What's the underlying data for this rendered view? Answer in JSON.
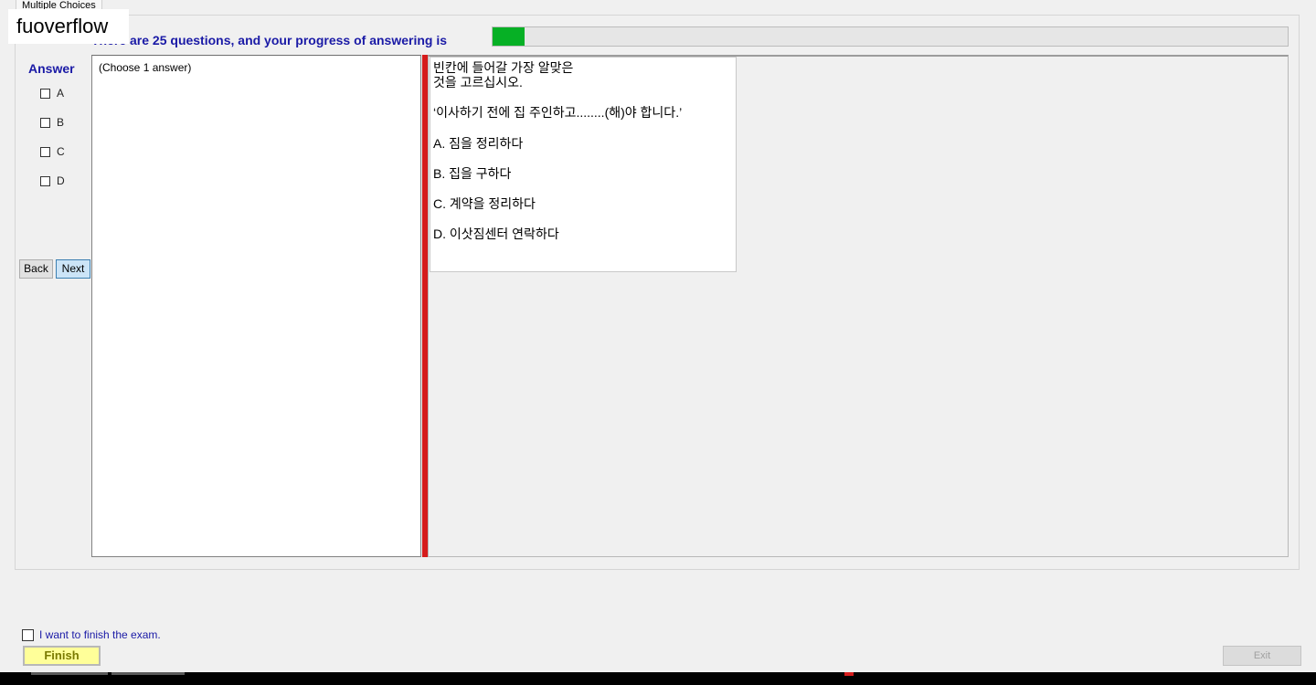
{
  "window": {
    "tab_label": "Multiple Choices",
    "watermark": "fuoverflow"
  },
  "progress": {
    "text": "There are 25 questions, and your progress of answering is",
    "fraction": 0.04,
    "fill_color": "#06b025"
  },
  "answer": {
    "title": "Answer",
    "options": [
      "A",
      "B",
      "C",
      "D"
    ],
    "hint": "(Choose 1 answer)"
  },
  "nav": {
    "back_label": "Back",
    "next_label": "Next"
  },
  "question": {
    "lines": [
      "빈칸에 들어갈 가장 알맞은",
      "것을 고르십시오.",
      "‘이사하기 전에 집 주인하고........(해)야 합니다.’",
      "A.  짐을 정리하다",
      "B.  집을 구하다",
      "C.  계약을 정리하다",
      "D.  이삿짐센터 연락하다"
    ]
  },
  "footer": {
    "finish_checkbox_label": "I want to finish the exam.",
    "finish_label": "Finish",
    "exit_label": "Exit"
  },
  "colors": {
    "accent_text": "#1a1aa6",
    "splitter": "#d51c1c",
    "finish_bg": "#ffff99"
  }
}
